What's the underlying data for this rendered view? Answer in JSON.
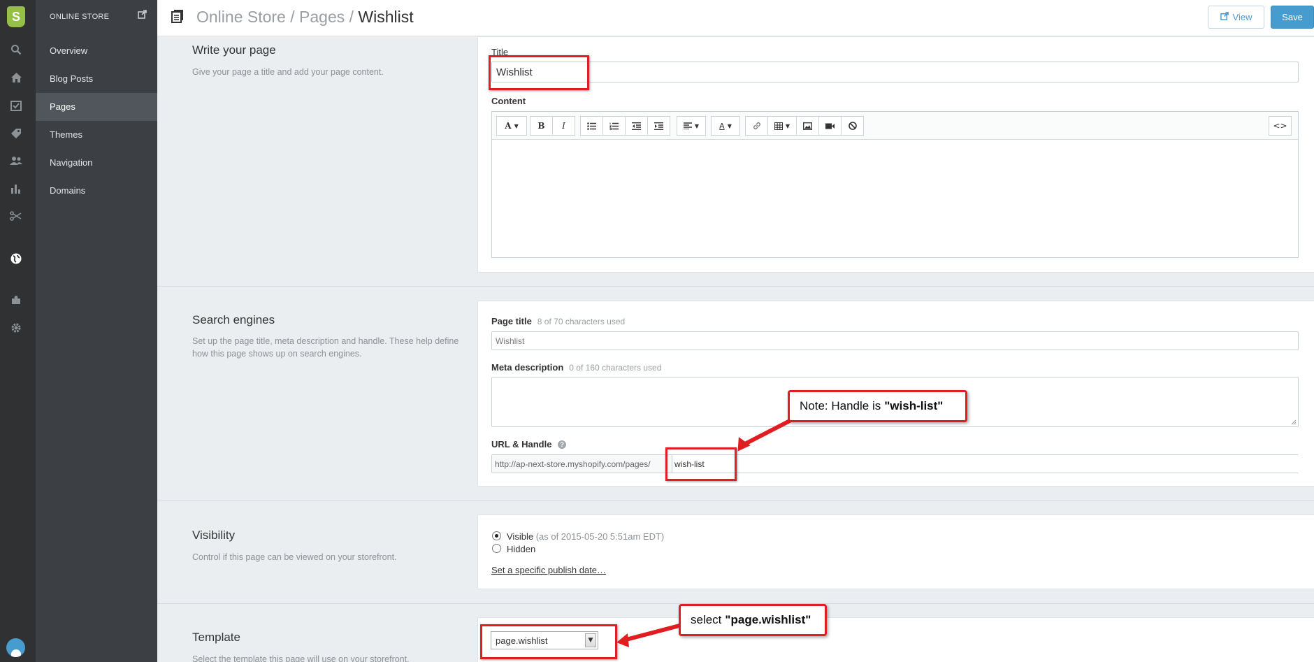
{
  "rail": {
    "logo": "S",
    "icons": [
      "search-icon",
      "home-icon",
      "orders-icon",
      "products-icon",
      "customers-icon",
      "reports-icon",
      "discounts-icon",
      "online-store-icon",
      "apps-icon",
      "settings-icon",
      "account-icon"
    ]
  },
  "sidebar": {
    "heading": "ONLINE STORE",
    "items": [
      {
        "label": "Overview"
      },
      {
        "label": "Blog Posts"
      },
      {
        "label": "Pages"
      },
      {
        "label": "Themes"
      },
      {
        "label": "Navigation"
      },
      {
        "label": "Domains"
      }
    ],
    "active": "Pages"
  },
  "header": {
    "crumb_1": "Online Store",
    "sep": "/",
    "crumb_2": "Pages",
    "current": "Wishlist",
    "view_label": "View",
    "save_label": "Save"
  },
  "write": {
    "title": "Write your page",
    "desc": "Give your page a title and add your page content.",
    "title_label": "Title",
    "title_value": "Wishlist",
    "content_label": "Content",
    "toolbar": {
      "font": "A",
      "bold": "B",
      "italic": "I",
      "source": "<>"
    }
  },
  "seo": {
    "title": "Search engines",
    "desc": "Set up the page title, meta description and handle. These help define how this page shows up on search engines.",
    "page_title_label": "Page title",
    "page_title_hint": "8 of 70 characters used",
    "page_title_placeholder": "Wishlist",
    "meta_label": "Meta description",
    "meta_hint": "0 of 160 characters used",
    "url_label": "URL & Handle",
    "url_prefix": "http://ap-next-store.myshopify.com/pages/",
    "handle_value": "wish-list"
  },
  "visibility": {
    "title": "Visibility",
    "desc": "Control if this page can be viewed on your storefront.",
    "visible_label": "Visible",
    "visible_note": "(as of 2015-05-20 5:51am EDT)",
    "hidden_label": "Hidden",
    "publish_link": "Set a specific publish date…",
    "selected": "Visible"
  },
  "template": {
    "title": "Template",
    "desc": "Select the template this page will use on your storefront.",
    "selected": "page.wishlist"
  },
  "annotations": {
    "handle_note_prefix": "Note: Handle is",
    "handle_note_value": "\"wish-list\"",
    "select_prefix": "select",
    "select_value": "\"page.wishlist\""
  },
  "colors": {
    "accent": "#479ccf",
    "annotation_red": "#e01e22",
    "sidebar_bg": "#3c4045",
    "rail_bg": "#2f3133"
  }
}
